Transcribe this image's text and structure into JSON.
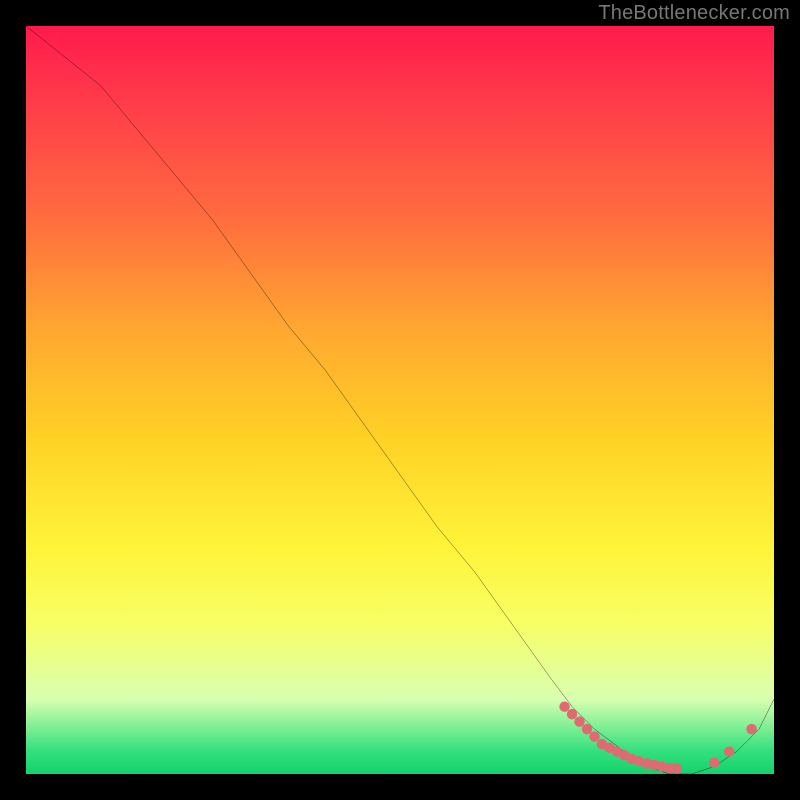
{
  "watermark": "TheBottlenecker.com",
  "chart_data": {
    "type": "line",
    "title": "",
    "xlabel": "",
    "ylabel": "",
    "xlim": [
      0,
      100
    ],
    "ylim": [
      0,
      100
    ],
    "grid": false,
    "series": [
      {
        "name": "curve",
        "x": [
          0,
          5,
          10,
          15,
          20,
          25,
          30,
          35,
          40,
          45,
          50,
          55,
          60,
          65,
          70,
          73,
          76,
          80,
          83,
          86,
          89,
          92,
          95,
          98,
          100
        ],
        "values": [
          100,
          96,
          92,
          86,
          80,
          74,
          67,
          60,
          54,
          47,
          40,
          33,
          27,
          20,
          13,
          9,
          6,
          3,
          1,
          0,
          0,
          1,
          3,
          6,
          10
        ]
      }
    ],
    "markers": {
      "name": "dots",
      "color": "#e06a72",
      "x": [
        72,
        73,
        74,
        75,
        76,
        77,
        78,
        79,
        80,
        81,
        82,
        83,
        84,
        85,
        86,
        87,
        92,
        94,
        97
      ],
      "values": [
        9,
        8,
        7,
        6,
        5,
        4,
        3.5,
        3,
        2.5,
        2,
        1.7,
        1.4,
        1.2,
        1,
        0.8,
        0.7,
        1.5,
        3,
        6
      ]
    },
    "background_gradient": {
      "direction": "vertical",
      "stops": [
        {
          "pos": 0.0,
          "color": "#ff1a4d"
        },
        {
          "pos": 0.1,
          "color": "#ff3b4a"
        },
        {
          "pos": 0.25,
          "color": "#ff6a3f"
        },
        {
          "pos": 0.4,
          "color": "#ffa531"
        },
        {
          "pos": 0.55,
          "color": "#ffd125"
        },
        {
          "pos": 0.7,
          "color": "#fff43a"
        },
        {
          "pos": 0.8,
          "color": "#f7ff66"
        },
        {
          "pos": 0.9,
          "color": "#d8ffb0"
        },
        {
          "pos": 0.97,
          "color": "#31e07d"
        },
        {
          "pos": 1.0,
          "color": "#15d26c"
        }
      ]
    }
  }
}
